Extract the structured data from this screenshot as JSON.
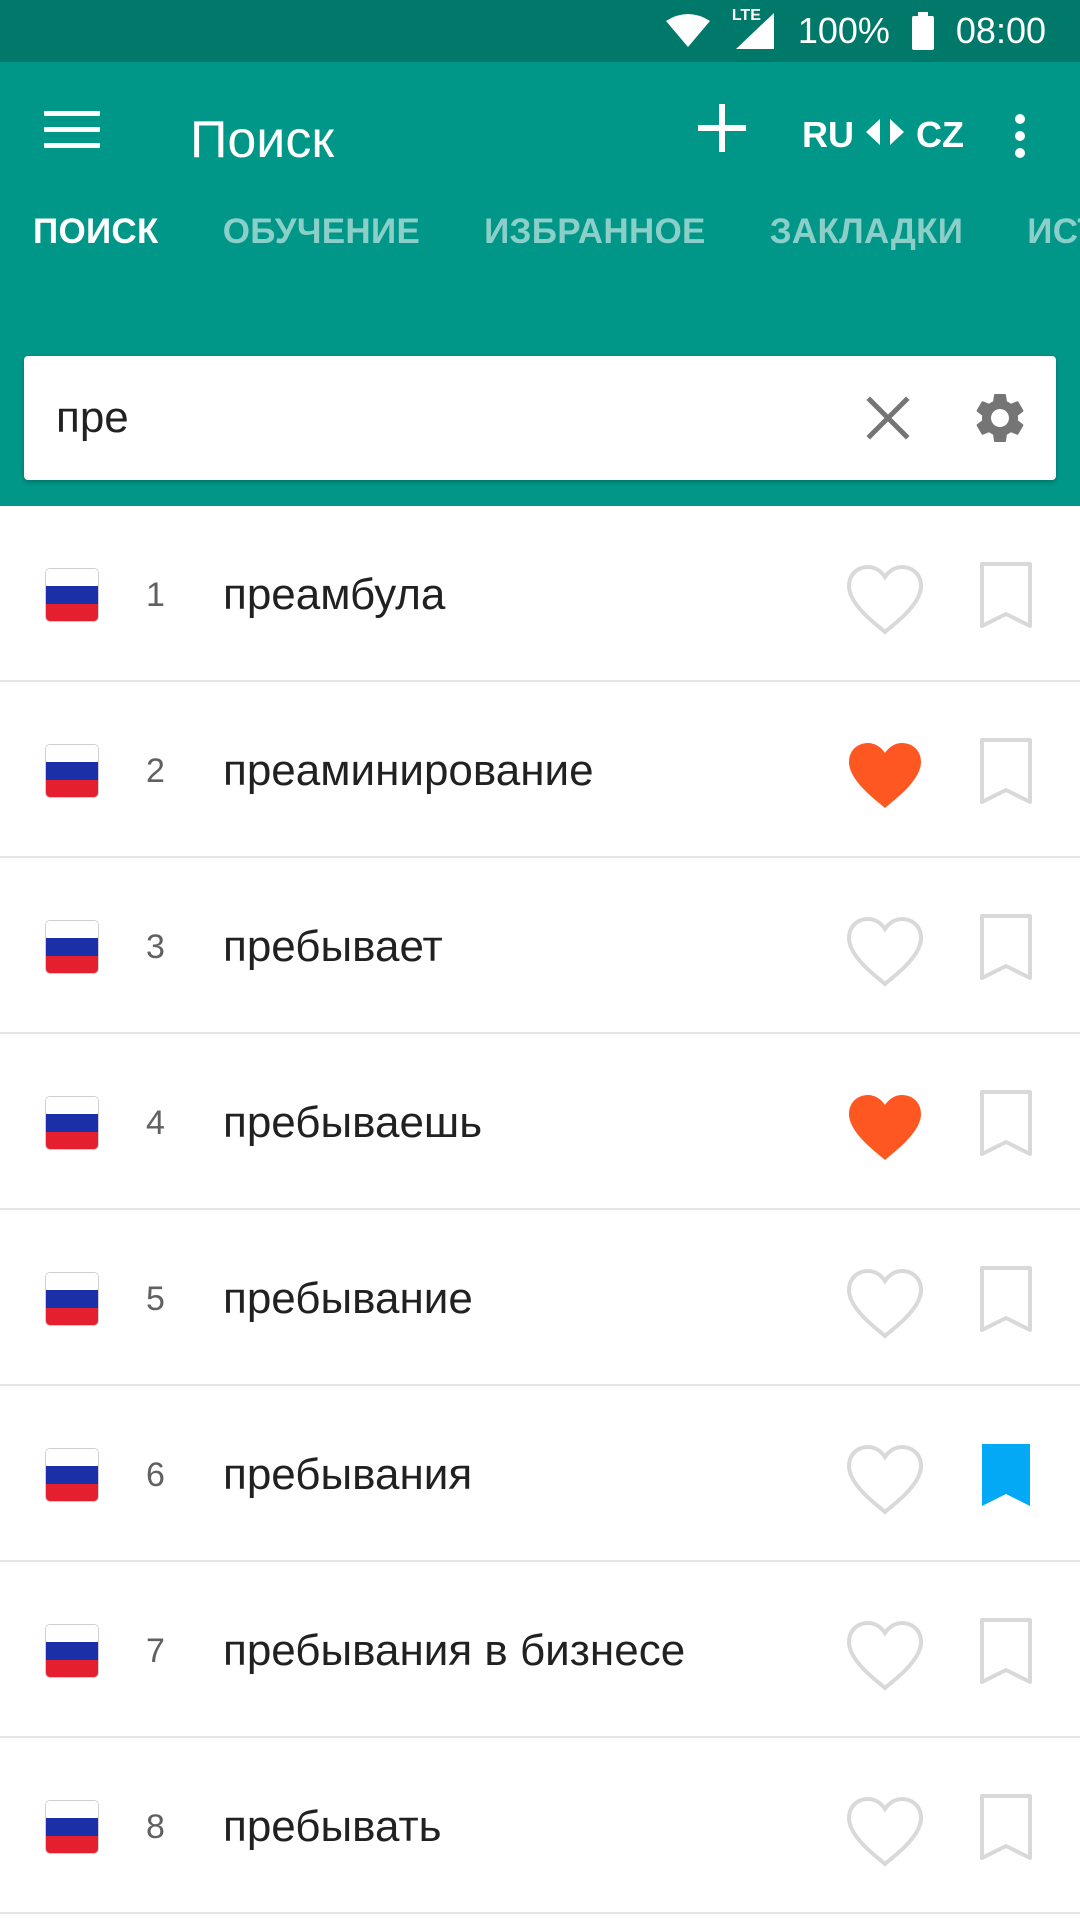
{
  "status_bar": {
    "network": "LTE",
    "battery": "100%",
    "time": "08:00"
  },
  "toolbar": {
    "title": "Поиск",
    "lang_from": "RU",
    "lang_to": "CZ",
    "icons": [
      "menu-icon",
      "plus-icon",
      "swap-icon",
      "more-vert-icon"
    ]
  },
  "tabs": [
    {
      "label": "ПОИСК",
      "active": true
    },
    {
      "label": "ОБУЧЕНИЕ",
      "active": false
    },
    {
      "label": "ИЗБРАННОЕ",
      "active": false
    },
    {
      "label": "ЗАКЛАДКИ",
      "active": false
    },
    {
      "label": "ИСТ",
      "active": false
    }
  ],
  "search": {
    "value": "пре",
    "icons": [
      "clear-icon",
      "gear-icon"
    ]
  },
  "colors": {
    "status_bar": "#00796b",
    "primary": "#009688",
    "favorite_active": "#ff5722",
    "bookmark_active": "#03a9f4",
    "inactive_icon": "#d9d9d9"
  },
  "results": [
    {
      "num": "1",
      "word": "преамбула",
      "favorite": false,
      "bookmarked": false
    },
    {
      "num": "2",
      "word": "преаминирование",
      "favorite": true,
      "bookmarked": false
    },
    {
      "num": "3",
      "word": "пребывает",
      "favorite": false,
      "bookmarked": false
    },
    {
      "num": "4",
      "word": "пребываешь",
      "favorite": true,
      "bookmarked": false
    },
    {
      "num": "5",
      "word": "пребывание",
      "favorite": false,
      "bookmarked": false
    },
    {
      "num": "6",
      "word": "пребывания",
      "favorite": false,
      "bookmarked": true
    },
    {
      "num": "7",
      "word": "пребывания в бизнесе",
      "favorite": false,
      "bookmarked": false
    },
    {
      "num": "8",
      "word": "пребывать",
      "favorite": false,
      "bookmarked": false
    }
  ]
}
